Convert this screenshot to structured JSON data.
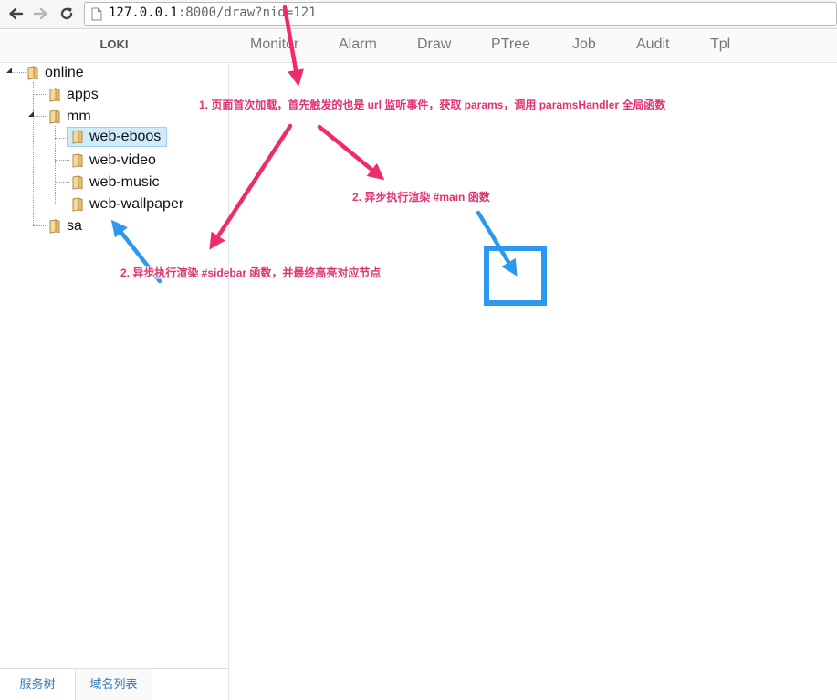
{
  "browser": {
    "url_host": "127.0.0.1",
    "url_rest": ":8000/draw?nid=121"
  },
  "header": {
    "brand": "LOKI",
    "nav": [
      "Monitor",
      "Alarm",
      "Draw",
      "PTree",
      "Job",
      "Audit",
      "Tpl"
    ]
  },
  "tree": {
    "root": "online",
    "children": {
      "apps": "apps",
      "mm": "mm",
      "mm_children": [
        "web-eboos",
        "web-video",
        "web-music",
        "web-wallpaper"
      ],
      "sa": "sa"
    },
    "selected": "web-eboos"
  },
  "bottom_tabs": [
    "服务树",
    "域名列表"
  ],
  "annotations": {
    "note1": "1. 页面首次加载，首先触发的也是 url 监听事件，获取 params，调用 paramsHandler 全局函数",
    "note2_main": "2. 异步执行渲染 #main 函数",
    "note2_sidebar": "2. 异步执行渲染 #sidebar 函数，并最终高亮对应节点"
  },
  "colors": {
    "annotation_pink": "#e33271",
    "annotation_blue": "#2e97f0",
    "selection_bg": "#d0ecfb",
    "tab_text": "#3579b5"
  }
}
